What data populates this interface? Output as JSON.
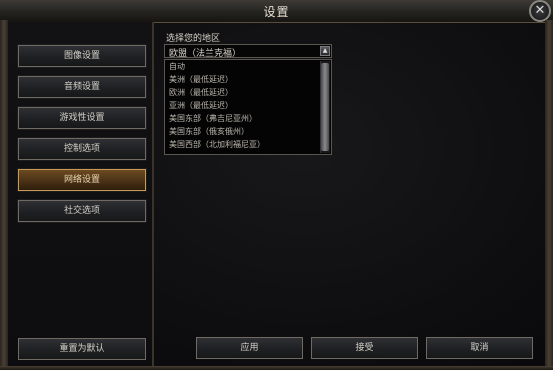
{
  "window": {
    "title": "设置"
  },
  "nav": {
    "items": [
      {
        "label": "图像设置",
        "active": false
      },
      {
        "label": "音频设置",
        "active": false
      },
      {
        "label": "游戏性设置",
        "active": false
      },
      {
        "label": "控制选项",
        "active": false
      },
      {
        "label": "网络设置",
        "active": true
      },
      {
        "label": "社交选项",
        "active": false
      }
    ],
    "reset_label": "重置为默认"
  },
  "network": {
    "region_label": "选择您的地区",
    "selected_region": "欧盟（法兰克福）",
    "options": [
      "自动",
      "美洲（最低延迟）",
      "欧洲（最低延迟）",
      "亚洲（最低延迟）",
      "美国东部（弗吉尼亚州）",
      "美国东部（俄亥俄州）",
      "美国西部（北加利福尼亚）"
    ]
  },
  "footer": {
    "apply_label": "应用",
    "accept_label": "接受",
    "cancel_label": "取消"
  },
  "icons": {
    "close": "close-icon",
    "dropdown": "triangle-up-icon"
  },
  "colors": {
    "accent": "#c79a52",
    "active_button": "#4b3216",
    "background": "#0b0b0c"
  }
}
